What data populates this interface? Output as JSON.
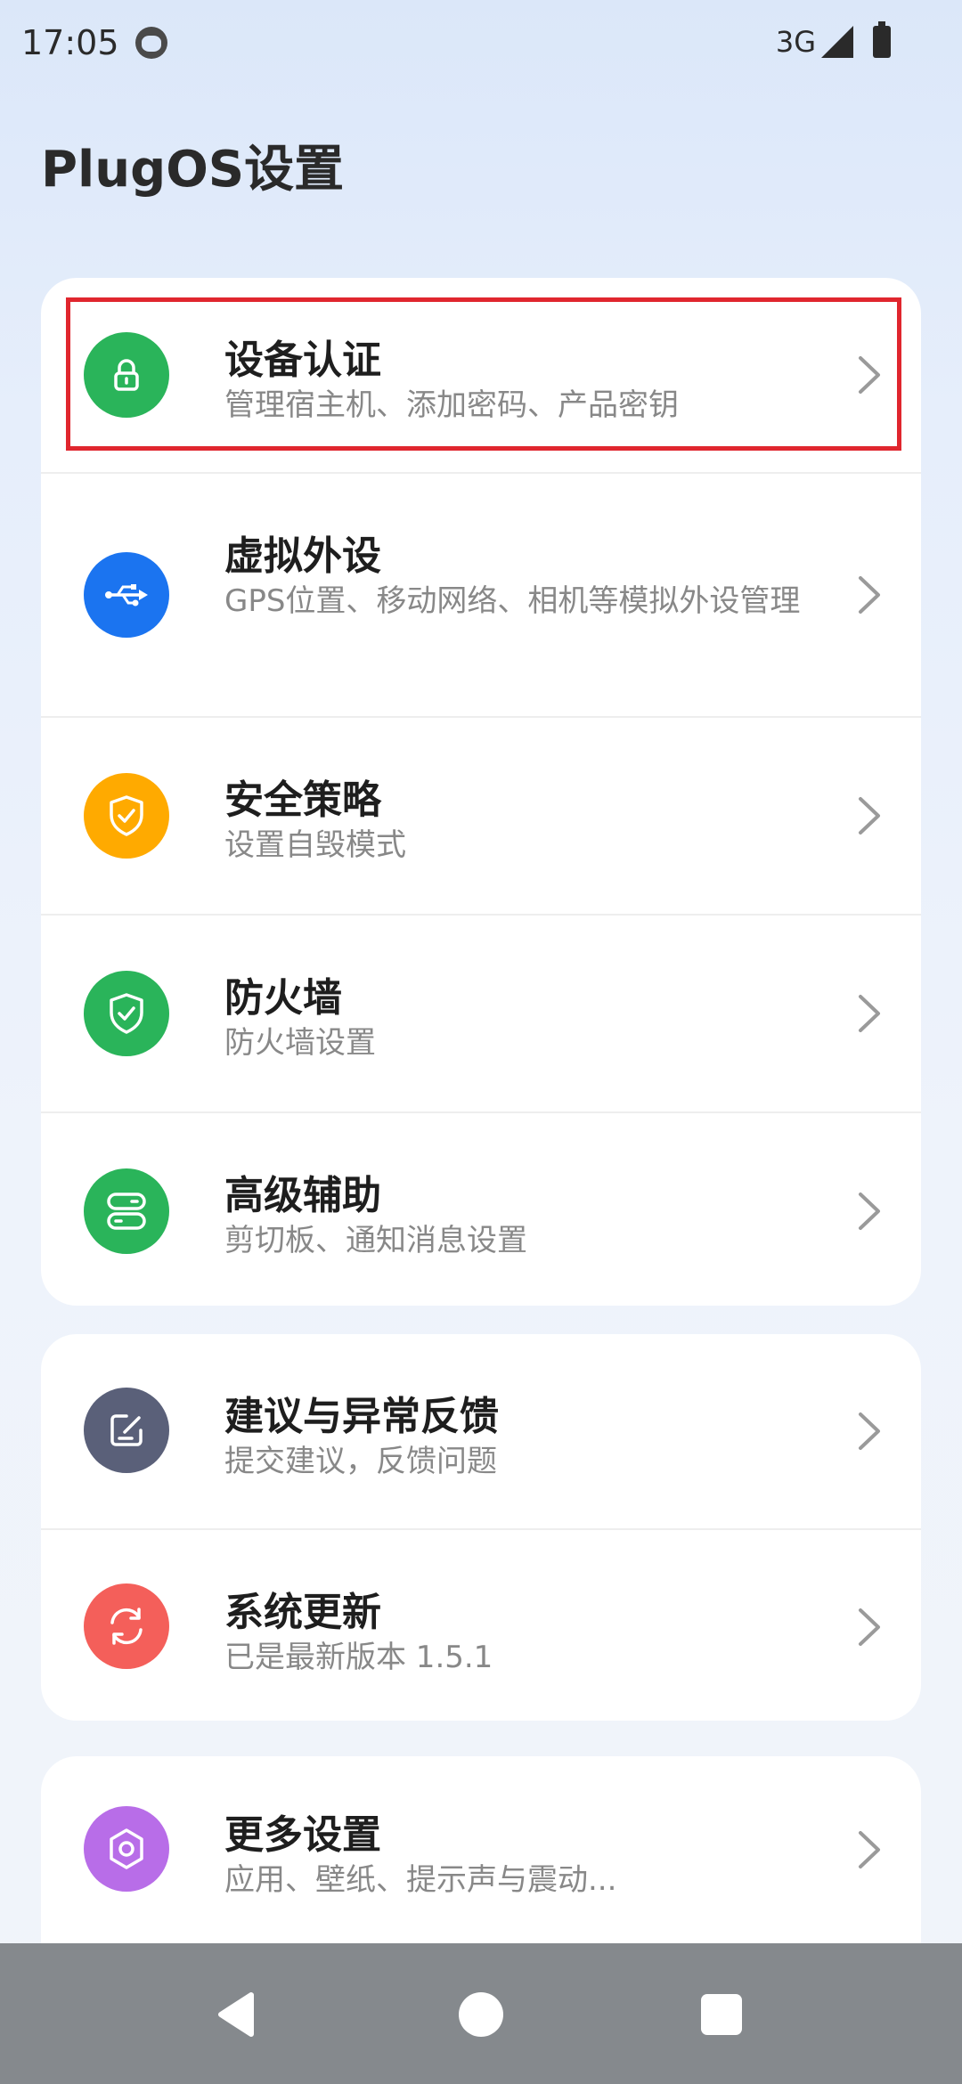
{
  "status_bar": {
    "time": "17:05",
    "network": "3G"
  },
  "page": {
    "title": "PlugOS设置"
  },
  "card1": {
    "items": [
      {
        "title": "设备认证",
        "subtitle": "管理宿主机、添加密码、产品密钥",
        "icon": "lock-icon",
        "color": "#2ab45a"
      },
      {
        "title": "虚拟外设",
        "subtitle": "GPS位置、移动网络、相机等模拟外设管理",
        "icon": "usb-icon",
        "color": "#1b74f0"
      },
      {
        "title": "安全策略",
        "subtitle": "设置自毁模式",
        "icon": "shield-check-icon",
        "color": "#ffaa00"
      },
      {
        "title": "防火墙",
        "subtitle": "防火墙设置",
        "icon": "shield-check-icon",
        "color": "#2ab45a"
      },
      {
        "title": "高级辅助",
        "subtitle": "剪切板、通知消息设置",
        "icon": "toggle-icon",
        "color": "#2ab45a"
      }
    ]
  },
  "card2": {
    "items": [
      {
        "title": "建议与异常反馈",
        "subtitle": "提交建议，反馈问题",
        "icon": "edit-icon",
        "color": "#5a6079"
      },
      {
        "title": "系统更新",
        "subtitle": "已是最新版本 1.5.1",
        "icon": "refresh-icon",
        "color": "#f45f5a"
      }
    ]
  },
  "card3": {
    "items": [
      {
        "title": "更多设置",
        "subtitle": "应用、壁纸、提示声与震动...",
        "icon": "gear-icon",
        "color": "#b86de8"
      }
    ]
  },
  "nav_bar": {
    "back": "back-icon",
    "home": "home-icon",
    "recents": "recents-icon"
  }
}
